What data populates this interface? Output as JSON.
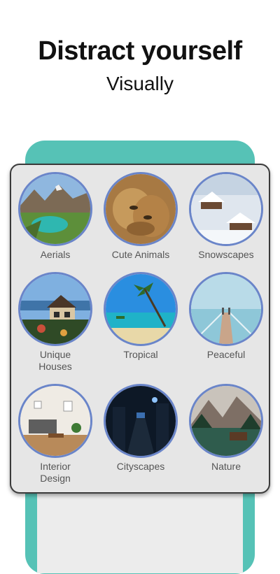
{
  "headline": "Distract yourself",
  "subheadline": "Visually",
  "categories": [
    {
      "label": "Aerials"
    },
    {
      "label": "Cute Animals"
    },
    {
      "label": "Snowscapes"
    },
    {
      "label": "Unique\nHouses"
    },
    {
      "label": "Tropical"
    },
    {
      "label": "Peaceful"
    },
    {
      "label": "Interior\nDesign"
    },
    {
      "label": "Cityscapes"
    },
    {
      "label": "Nature"
    }
  ],
  "colors": {
    "accent_teal": "#56c2b6",
    "thumb_ring": "#6a85c9",
    "card_bg": "#e6e6e6"
  }
}
